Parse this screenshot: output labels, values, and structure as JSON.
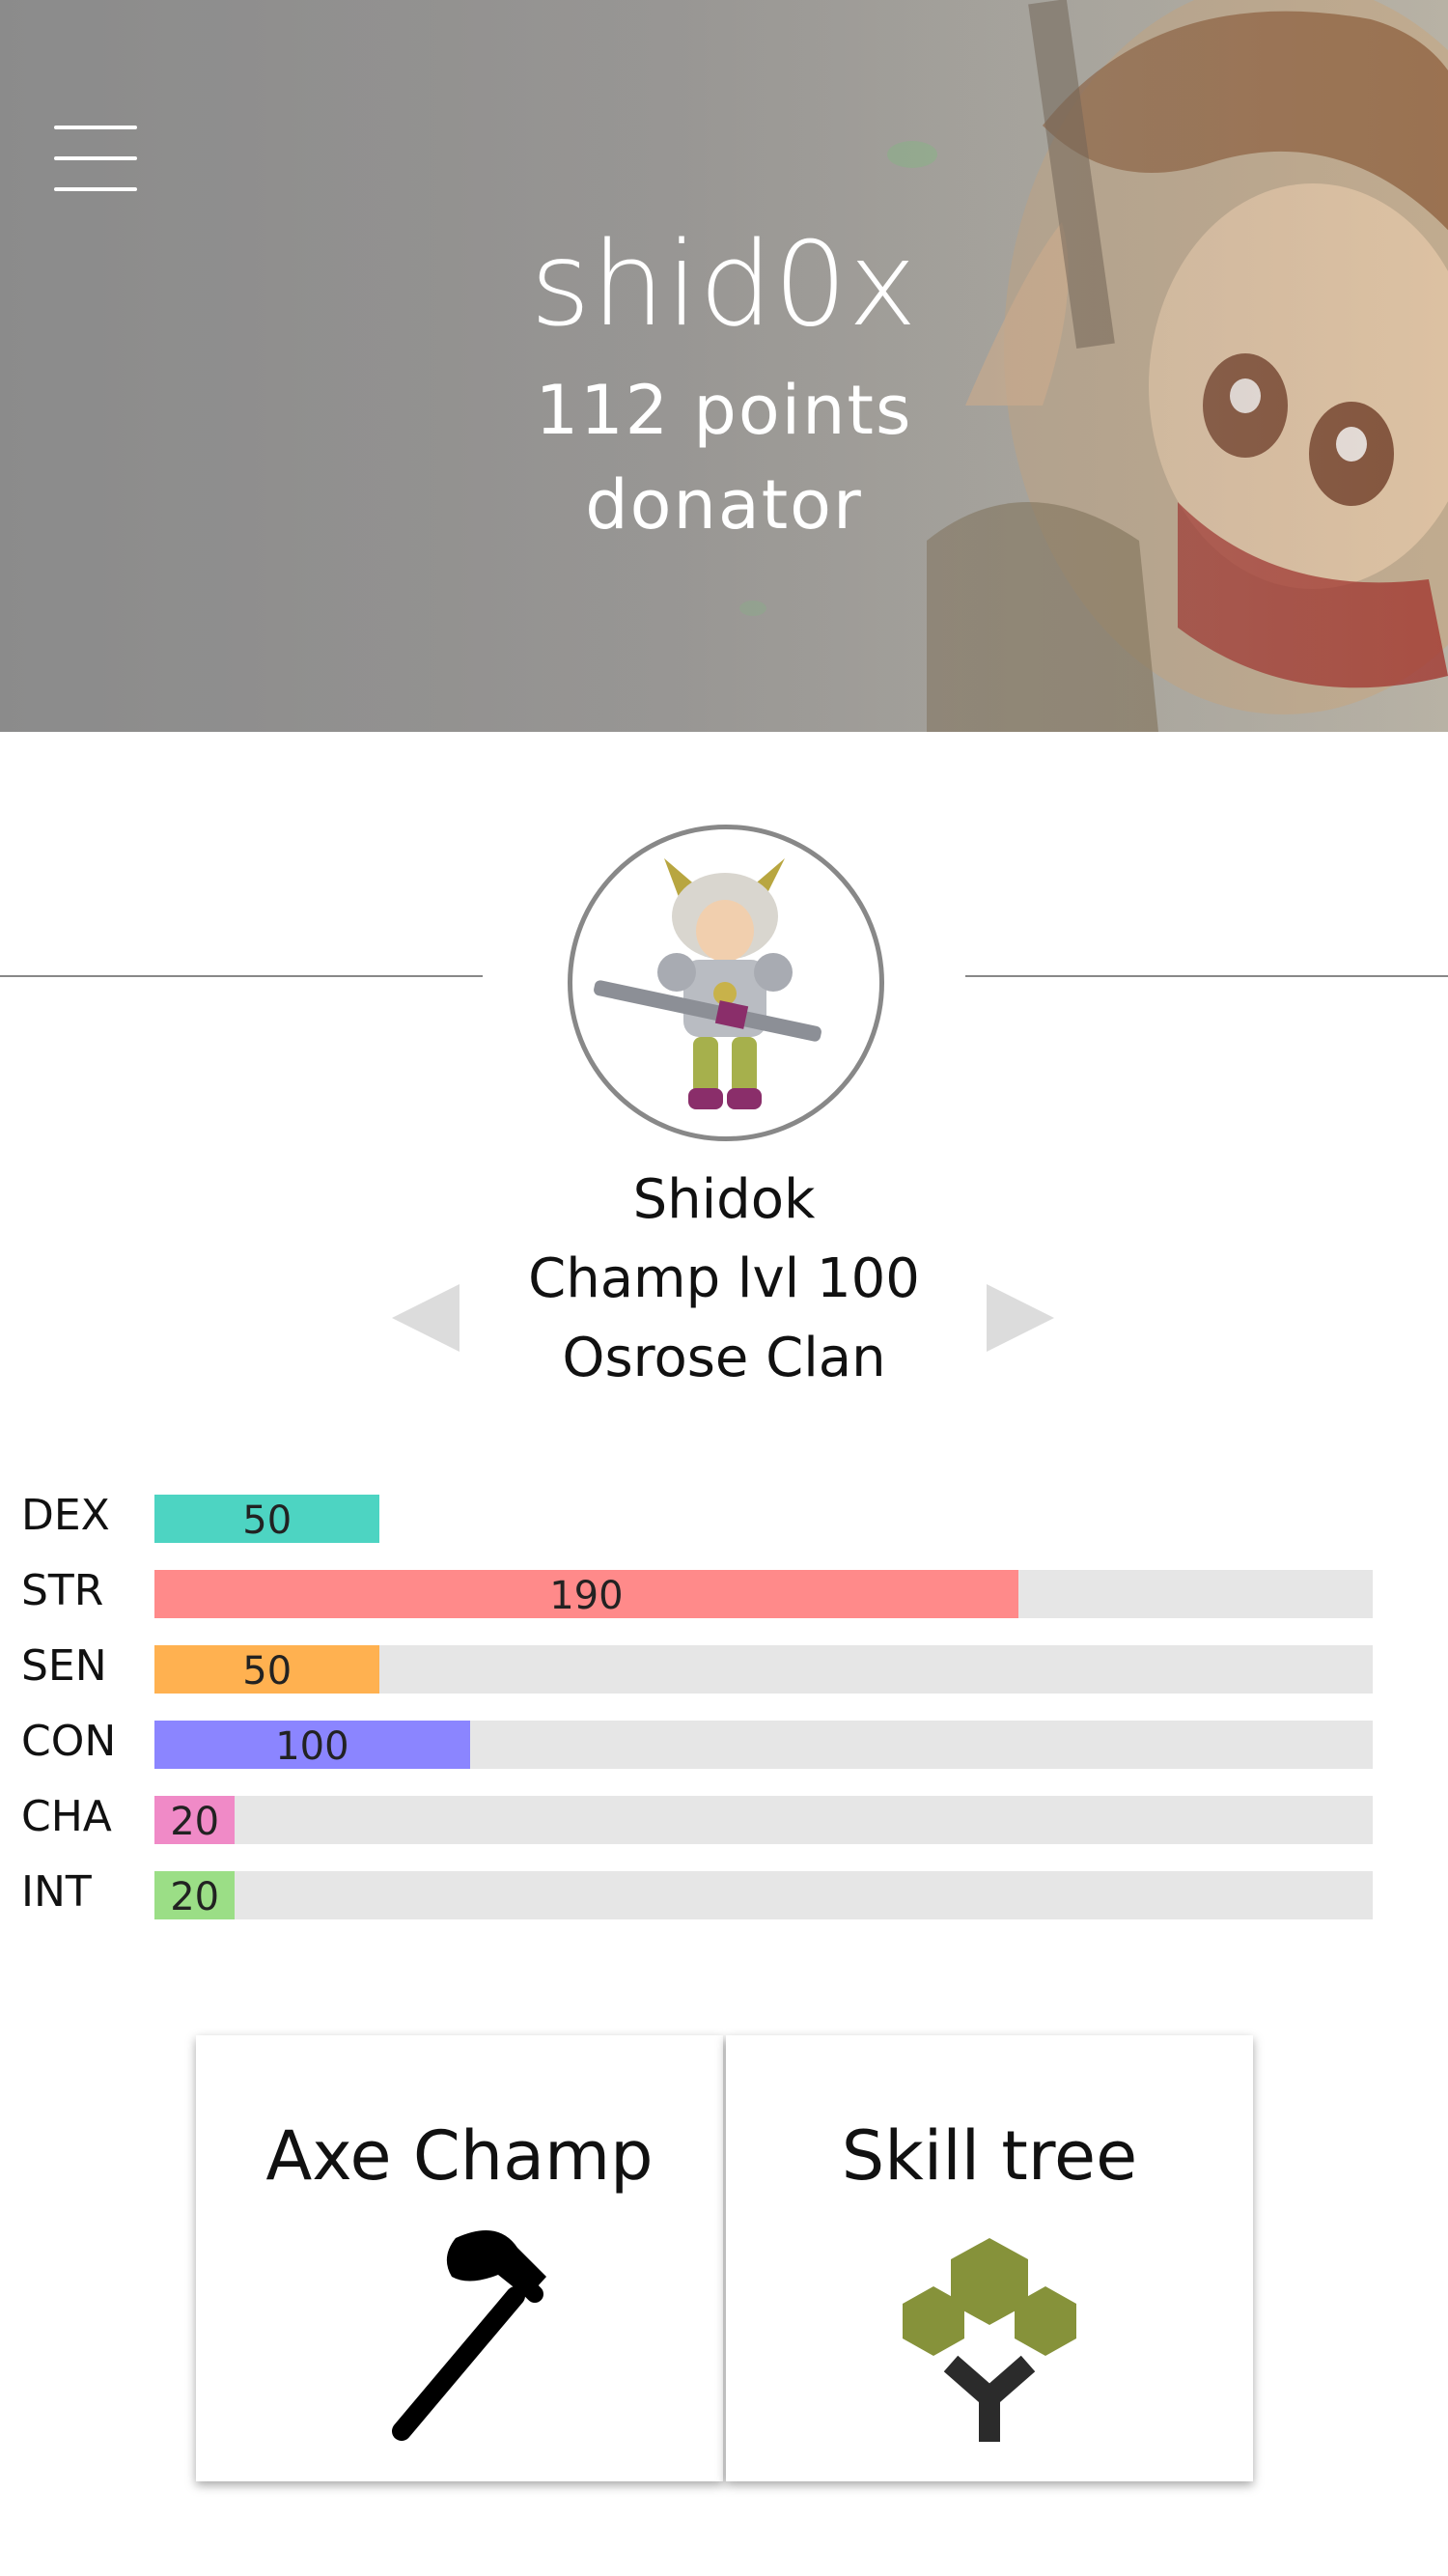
{
  "profile": {
    "username": "shid0x",
    "points": "112 points",
    "role": "donator"
  },
  "character": {
    "name": "Shidok",
    "class_level": "Champ lvl 100",
    "clan": "Osrose Clan"
  },
  "stats": [
    {
      "label": "DEX",
      "value": "50",
      "fraction": 0.185,
      "color": "#4dd4c2"
    },
    {
      "label": "STR",
      "value": "190",
      "fraction": 0.709,
      "color": "#ff8a8a"
    },
    {
      "label": "SEN",
      "value": "50",
      "fraction": 0.185,
      "color": "#ffb150"
    },
    {
      "label": "CON",
      "value": "100",
      "fraction": 0.259,
      "color": "#8b85ff"
    },
    {
      "label": "CHA",
      "value": "20",
      "fraction": 0.066,
      "color": "#f08ac7"
    },
    {
      "label": "INT",
      "value": "20",
      "fraction": 0.066,
      "color": "#9bde86"
    }
  ],
  "cards": {
    "weapon_label": "Axe Champ",
    "skill_tree_label": "Skill tree"
  },
  "icons": {
    "menu": "hamburger-menu-icon",
    "prev": "triangle-left-icon",
    "next": "triangle-right-icon",
    "weapon": "axe-icon",
    "skill_tree": "hexagon-tree-icon"
  }
}
